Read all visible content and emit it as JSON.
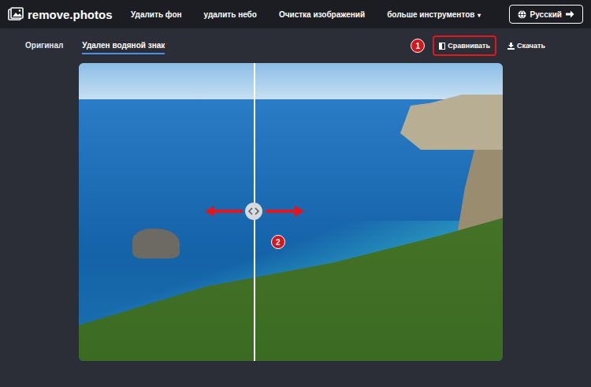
{
  "logo": {
    "text": "remove.photos"
  },
  "nav": [
    {
      "label": "Удалить фон",
      "caret": ""
    },
    {
      "label": "удалить небо",
      "caret": ""
    },
    {
      "label": "Очистка изображений",
      "caret": ""
    },
    {
      "label": "больше инструментов",
      "caret": "▾"
    }
  ],
  "language": {
    "label": "Русский"
  },
  "tabs": [
    {
      "label": "Оригинал",
      "selected": false
    },
    {
      "label": "Удален водяной знак",
      "selected": true
    }
  ],
  "actions": [
    {
      "label": "Сравнивать",
      "highlighted": true,
      "kind": "compare"
    },
    {
      "label": "Скачать",
      "highlighted": false,
      "kind": "download"
    }
  ],
  "annotations": [
    "1",
    "2"
  ],
  "compare": {
    "level": 0.414
  }
}
